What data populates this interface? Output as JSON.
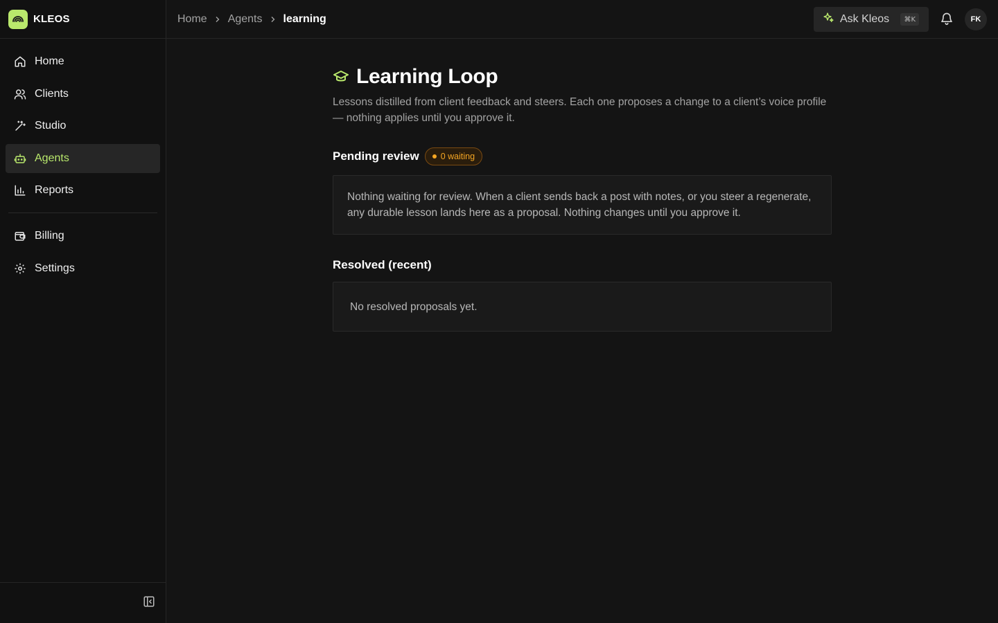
{
  "brand": {
    "name": "KLEOS",
    "accent": "#b9e86c"
  },
  "nav": {
    "items": [
      {
        "label": "Home",
        "icon": "home-icon"
      },
      {
        "label": "Clients",
        "icon": "users-icon"
      },
      {
        "label": "Studio",
        "icon": "magic-wand-icon"
      },
      {
        "label": "Agents",
        "icon": "robot-icon",
        "active": true
      },
      {
        "label": "Reports",
        "icon": "bar-chart-icon"
      }
    ],
    "secondary": [
      {
        "label": "Billing",
        "icon": "wallet-icon"
      },
      {
        "label": "Settings",
        "icon": "gear-icon"
      }
    ]
  },
  "breadcrumb": [
    "Home",
    "Agents",
    "learning"
  ],
  "header": {
    "ask_label": "Ask Kleos",
    "ask_shortcut": "⌘K",
    "avatar_initials": "FK"
  },
  "page": {
    "title": "Learning Loop",
    "description": "Lessons distilled from client feedback and steers. Each one proposes a change to a client’s voice profile — nothing applies until you approve it."
  },
  "pending": {
    "title": "Pending review",
    "badge": "0 waiting",
    "badge_color": "#f5a623",
    "empty_text": "Nothing waiting for review. When a client sends back a post with notes, or you steer a regenerate, any durable lesson lands here as a proposal. Nothing changes until you approve it."
  },
  "resolved": {
    "title": "Resolved (recent)",
    "empty_text": "No resolved proposals yet."
  }
}
